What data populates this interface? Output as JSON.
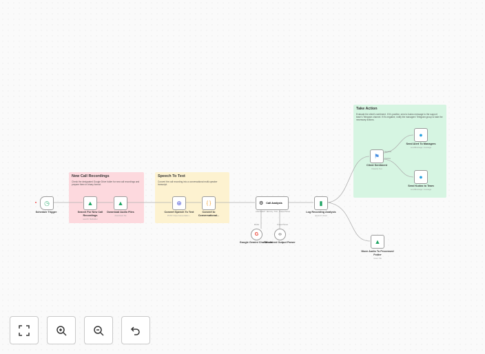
{
  "stickies": [
    {
      "title": "New Call Recordings",
      "text": "Check the designated Google Drive folder for new call recordings and prepare them in binary format.",
      "color": "#fdd9de"
    },
    {
      "title": "Speech To Text",
      "text": "Convert the call recording into a conversational multi-speaker transcript.",
      "color": "#fdf2d0"
    },
    {
      "title": "Take Action",
      "text": "Evaluate the client's sentiment. If it's positive, send a kudos message to the support team's Telegram channel. If it's negative, notify the managers' Telegram group to take the necessary actions.",
      "color": "#d6f5e2"
    }
  ],
  "nodes": {
    "schedule": {
      "label": "Schedule Trigger",
      "icon": "clock-icon"
    },
    "search": {
      "label": "Search For New Call Recordings",
      "sub": "search: fileFolder",
      "icon": "google-drive-icon"
    },
    "download": {
      "label": "Download Audio Files",
      "sub": "download: file",
      "icon": "google-drive-icon"
    },
    "speech": {
      "label": "Convert Speech To Text",
      "sub": "POST: https://elevenlabs.i...",
      "icon": "globe-icon"
    },
    "convert": {
      "label": "Convert to Conversational...",
      "icon": "code-icon"
    },
    "analysis": {
      "label": "Call Analysis",
      "icon": "robot-icon",
      "ports": [
        "Chat Model*",
        "Memory",
        "Tool",
        "Output Parser"
      ]
    },
    "log": {
      "label": "Log Recording Analysis",
      "sub": "append: sheet",
      "icon": "google-sheets-icon"
    },
    "sentiment": {
      "label": "Client Sentiment",
      "sub": "Classify Text",
      "icon": "sign-icon",
      "outputs": [
        "Negative",
        "Positive"
      ]
    },
    "alert": {
      "label": "Send Alert To Managers",
      "sub": "sendMessage: message",
      "icon": "telegram-icon"
    },
    "kudos": {
      "label": "Send Kudos to Team",
      "sub": "sendMessage: message",
      "icon": "telegram-icon"
    },
    "move": {
      "label": "Move Audio To Processed Folder",
      "sub": "move: file",
      "icon": "google-drive-icon"
    },
    "gemini": {
      "label": "Google Gemini Chat Model",
      "port": "Model",
      "icon": "google-icon"
    },
    "parser": {
      "label": "Structured Output Parser",
      "port": "Output Parser",
      "icon": "braces-icon"
    }
  },
  "controls": [
    "fit-view",
    "zoom-in",
    "zoom-out",
    "undo"
  ]
}
